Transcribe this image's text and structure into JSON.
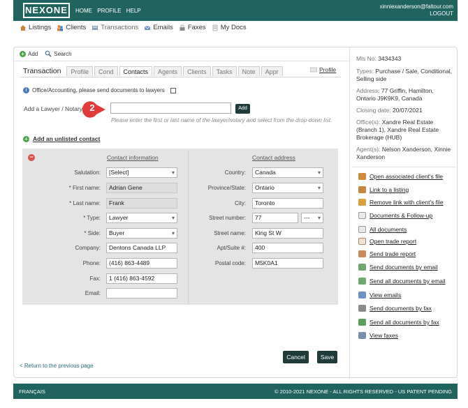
{
  "header": {
    "logo": "NEXONE",
    "nav": [
      "HOME",
      "PROFILE",
      "HELP"
    ],
    "user_email": "xinniexanderson@faltour.com",
    "logout": "LOGOUT"
  },
  "subnav": [
    {
      "label": "Listings",
      "icon": "house-icon"
    },
    {
      "label": "Clients",
      "icon": "people-icon"
    },
    {
      "label": "Transactions",
      "icon": "transactions-icon"
    },
    {
      "label": "Emails",
      "icon": "email-icon"
    },
    {
      "label": "Faxes",
      "icon": "fax-icon"
    },
    {
      "label": "My Docs",
      "icon": "docs-icon"
    }
  ],
  "toolbar": {
    "add": "Add",
    "search": "Search"
  },
  "tabs": {
    "title": "Transaction",
    "items": [
      "Profile",
      "Cond",
      "Contacts",
      "Agents",
      "Clients",
      "Tasks",
      "Note",
      "Appr"
    ],
    "active": "Contacts",
    "profile_link": "Profile"
  },
  "office_note": "Office/Accounting, please send documents to lawyers",
  "lawyer": {
    "label": "Add a Lawyer / Notary",
    "add_button": "Add",
    "hint": "Please enter the first or last name of the lawyer/notary and select from the drop-down list.",
    "step_marker": "2"
  },
  "unlisted_link": "Add an unlisted contact",
  "contact_info": {
    "heading": "Contact information",
    "salutation_label": "Salutation:",
    "salutation": "[Select]",
    "first_name_label": "* First name:",
    "first_name": "Adrian Gene",
    "last_name_label": "* Last name:",
    "last_name": "Frank",
    "type_label": "* Type:",
    "type": "Lawyer",
    "side_label": "* Side:",
    "side": "Buyer",
    "company_label": "Company:",
    "company": "Dentons Canada LLP",
    "phone_label": "Phone:",
    "phone": "(416) 863-4489",
    "fax_label": "Fax:",
    "fax": "1 (416) 863-4592",
    "email_label": "Email:",
    "email": ""
  },
  "contact_address": {
    "heading": "Contact address",
    "country_label": "Country:",
    "country": "Canada",
    "province_label": "Province/State:",
    "province": "Ontario",
    "city_label": "City:",
    "city": "Toronto",
    "street_number_label": "Street number:",
    "street_number": "77",
    "street_suffix": "---",
    "street_name_label": "Street name:",
    "street_name": "King St W",
    "apt_label": "Apt/Suite #:",
    "apt": "400",
    "postal_label": "Postal code:",
    "postal": "M5K0A1"
  },
  "buttons": {
    "cancel": "Cancel",
    "save": "Save"
  },
  "return_link": "< Return to the previous page",
  "sidebar": {
    "mls_label": "Mls No:",
    "mls": "3434343",
    "types_label": "Types:",
    "types": "Purchase / Sale, Conditional, Selling side",
    "address_label": "Address:",
    "address": "77 Griffin, Hamilton, Ontario J9K9K9, Canada",
    "closing_label": "Closing date:",
    "closing": "20/07/2021",
    "offices_label": "Office(s):",
    "offices": "Xandre Real Estate (Branch 1), Xandre Real Estate Brokerage (HUB)",
    "agents_label": "Agent(s):",
    "agents": "Nelson Xanderson, Xinnie Xanderson",
    "actions": [
      "Open associated client's file",
      "Link to a listing",
      "Remove link with client's file",
      "Documents & Follow-up",
      "All documents",
      "Open trade report",
      "Send trade report",
      "Send documents by email",
      "Send all documents by email",
      "View emails",
      "Send documents by fax",
      "Send all documents by fax",
      "View faxes"
    ]
  },
  "footer": {
    "language": "FRANÇAIS",
    "copyright": "© 2010-2021 NEXONE - ALL RIGHTS RESERVED - US PATENT PENDING"
  },
  "colors": {
    "brand": "#20635f",
    "button": "#1f3b3a",
    "marker": "#e03a3a"
  }
}
